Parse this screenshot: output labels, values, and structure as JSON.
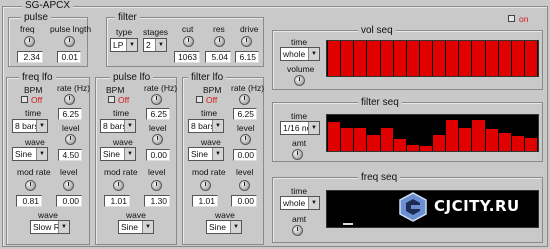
{
  "app_title": "SG-APCX",
  "power": {
    "label": "on"
  },
  "pulse": {
    "title": "pulse",
    "freq_label": "freq",
    "freq_value": "2.34",
    "length_label": "pulse lngth",
    "length_value": "0.01"
  },
  "filter": {
    "title": "filter",
    "type_label": "type",
    "type_value": "LP",
    "stages_label": "stages",
    "stages_value": "2",
    "cut_label": "cut",
    "cut_value": "1063",
    "res_label": "res",
    "res_value": "5.04",
    "drive_label": "drive",
    "drive_value": "6.15"
  },
  "freq_lfo": {
    "title": "freq lfo",
    "bpm_label": "BPM",
    "off_label": "Off",
    "rate_label": "rate (Hz)",
    "rate_value": "6.25",
    "time_label": "time",
    "time_value": "8 bars",
    "level_label": "level",
    "level_value": "4.50",
    "wave_label": "wave",
    "wave_value": "Sine",
    "modrate_label": "mod rate",
    "modrate_value": "0.81",
    "level2_label": "level",
    "level2_value": "0.00",
    "wave2_label": "wave",
    "wave2_value": "Slow R"
  },
  "pulse_lfo": {
    "title": "pulse lfo",
    "bpm_label": "BPM",
    "off_label": "Off",
    "rate_label": "rate (Hz)",
    "rate_value": "6.25",
    "time_label": "time",
    "time_value": "8 bars",
    "level_label": "level",
    "level_value": "0.00",
    "wave_label": "wave",
    "wave_value": "Sine",
    "modrate_label": "mod rate",
    "modrate_value": "1.01",
    "level2_label": "level",
    "level2_value": "1.30",
    "wave2_label": "wave",
    "wave2_value": "Sine"
  },
  "filter_lfo": {
    "title": "filter lfo",
    "bpm_label": "BPM",
    "off_label": "Off",
    "rate_label": "rate (Hz)",
    "rate_value": "6.25",
    "time_label": "time",
    "time_value": "8 bars",
    "level_label": "level",
    "level_value": "0.00",
    "wave_label": "wave",
    "wave_value": "Sine",
    "modrate_label": "mod rate",
    "modrate_value": "1.01",
    "level2_label": "level",
    "level2_value": "0.00",
    "wave2_label": "wave",
    "wave2_value": "Sine"
  },
  "vol_seq": {
    "title": "vol seq",
    "time_label": "time",
    "time_value": "whole",
    "volume_label": "volume",
    "steps": [
      1,
      1,
      1,
      1,
      1,
      1,
      1,
      1,
      1,
      1,
      1,
      1,
      1,
      1,
      1,
      1
    ]
  },
  "filter_seq": {
    "title": "filter seq",
    "time_label": "time",
    "time_value": "1/16 no",
    "amt_label": "amt",
    "steps": [
      0.8,
      0.65,
      0.65,
      0.45,
      0.65,
      0.32,
      0.18,
      0.15,
      0.45,
      0.85,
      0.65,
      0.85,
      0.62,
      0.5,
      0.42,
      0.35
    ]
  },
  "freq_seq": {
    "title": "freq seq",
    "time_label": "time",
    "time_value": "whole",
    "amt_label": "amt"
  },
  "watermark": {
    "text": "CJCITY.RU"
  },
  "colors": {
    "bar": "#e00000",
    "off": "#d21c1c",
    "screen": "#000000",
    "panel": "#c9c9c9"
  },
  "icons": {
    "dropdown": "chevron-down-icon",
    "knob": "knob-icon",
    "led": "led-indicator-icon"
  }
}
